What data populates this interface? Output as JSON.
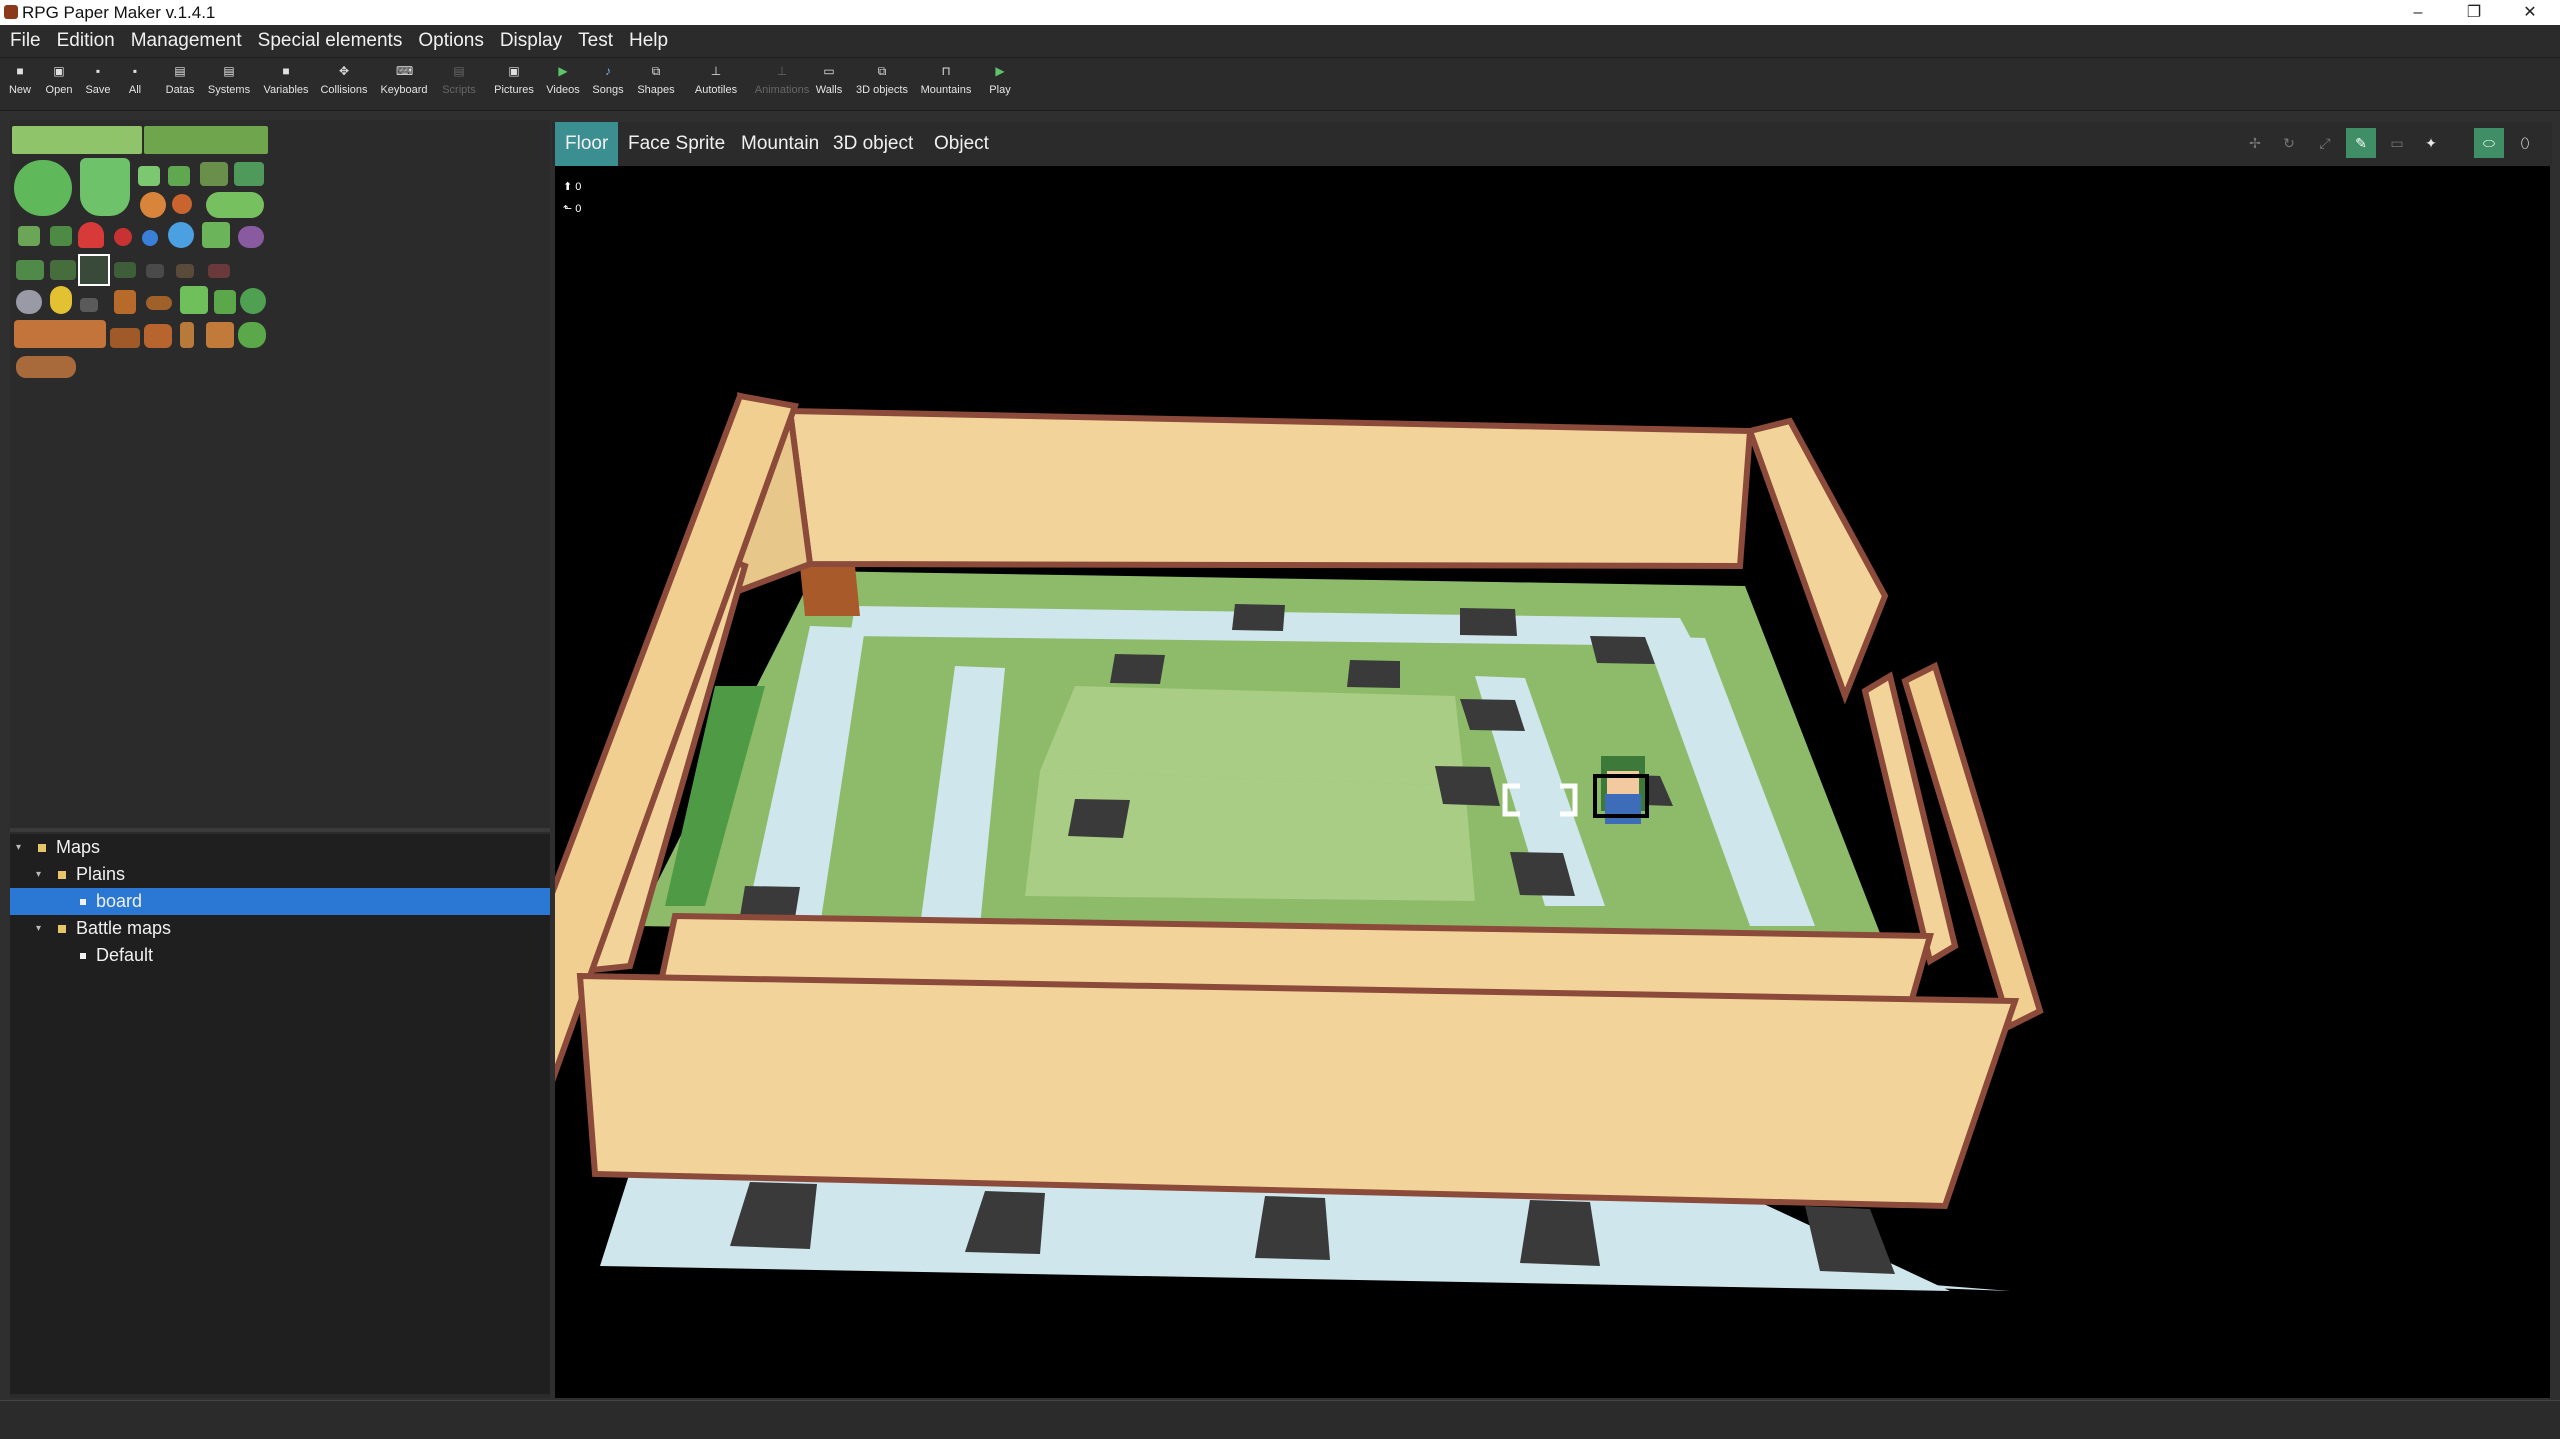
{
  "window": {
    "title": "RPG Paper Maker v.1.4.1",
    "controls": [
      "–",
      "❐",
      "✕"
    ]
  },
  "menu": [
    "File",
    "Edition",
    "Management",
    "Special elements",
    "Options",
    "Display",
    "Test",
    "Help"
  ],
  "toolbar": [
    {
      "label": "New",
      "icon": "new-icon",
      "enabled": true
    },
    {
      "label": "Open",
      "icon": "open-icon",
      "enabled": true
    },
    {
      "label": "Save",
      "icon": "save-icon",
      "enabled": true
    },
    {
      "label": "All",
      "icon": "save-all-icon",
      "enabled": true
    },
    {
      "label": "Datas",
      "icon": "datas-icon",
      "enabled": true
    },
    {
      "label": "Systems",
      "icon": "systems-icon",
      "enabled": true
    },
    {
      "label": "Variables",
      "icon": "variables-icon",
      "enabled": true
    },
    {
      "label": "Collisions",
      "icon": "collisions-icon",
      "enabled": true
    },
    {
      "label": "Keyboard",
      "icon": "keyboard-icon",
      "enabled": true
    },
    {
      "label": "Scripts",
      "icon": "scripts-icon",
      "enabled": false
    },
    {
      "label": "Pictures",
      "icon": "pictures-icon",
      "enabled": true
    },
    {
      "label": "Videos",
      "icon": "videos-icon",
      "enabled": true
    },
    {
      "label": "Songs",
      "icon": "songs-icon",
      "enabled": true
    },
    {
      "label": "Shapes",
      "icon": "shapes-icon",
      "enabled": true
    },
    {
      "label": "Autotiles",
      "icon": "autotiles-icon",
      "enabled": true
    },
    {
      "label": "Animations",
      "icon": "animations-icon",
      "enabled": false
    },
    {
      "label": "Walls",
      "icon": "walls-icon",
      "enabled": true
    },
    {
      "label": "3D objects",
      "icon": "objects-3d-icon",
      "enabled": true
    },
    {
      "label": "Mountains",
      "icon": "mountains-icon",
      "enabled": true
    },
    {
      "label": "Play",
      "icon": "play-icon",
      "enabled": true
    }
  ],
  "tabs": [
    "Floor",
    "Face Sprite",
    "Mountain",
    "3D object",
    "Object"
  ],
  "active_tab": "Floor",
  "coords": {
    "height": "0",
    "layer": "0"
  },
  "tree": [
    {
      "label": "Maps",
      "level": 0,
      "expanded": true,
      "selected": false
    },
    {
      "label": "Plains",
      "level": 1,
      "expanded": true,
      "selected": false
    },
    {
      "label": "board",
      "level": 2,
      "expanded": false,
      "selected": true
    },
    {
      "label": "Battle maps",
      "level": 1,
      "expanded": true,
      "selected": false
    },
    {
      "label": "Default",
      "level": 2,
      "expanded": false,
      "selected": false
    }
  ],
  "colors": {
    "accent_tab": "#3b8f91",
    "selection": "#2a78d4",
    "wall_face": "#f2d49a",
    "wall_edge": "#8b4a3a",
    "grass": "#8dbb6a",
    "grass_dark": "#6e9f4d",
    "ice": "#cfe6ec",
    "dark_tile": "#3a3a3a"
  }
}
